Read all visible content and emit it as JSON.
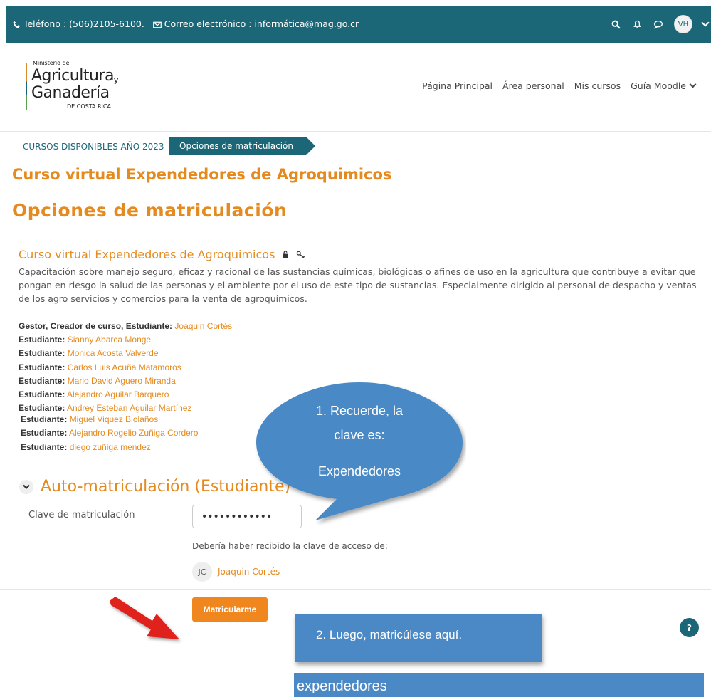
{
  "topbar": {
    "phone": "Teléfono : (506)2105-6100.",
    "email": "Correo electrónico : informática@mag.go.cr",
    "avatar_initials": "VH",
    "icons": [
      "phone-icon",
      "mail-icon",
      "search-icon",
      "bell-icon",
      "chat-icon",
      "chevron-down-icon"
    ]
  },
  "logo": {
    "line1": "Ministerio de",
    "line2": "Agricultura",
    "line2_suffix": "y",
    "line3": "Ganadería",
    "line4": "DE COSTA RICA"
  },
  "nav": {
    "items": [
      "Página Principal",
      "Área personal",
      "Mis cursos",
      "Guía Moodle"
    ]
  },
  "breadcrumb": {
    "items": [
      "CURSOS DISPONIBLES AÑO 2023",
      "Opciones de matriculación"
    ]
  },
  "course_title": "Curso virtual Expendedores de Agroquimicos",
  "page_title": "Opciones de matriculación",
  "course_box": {
    "title": "Curso virtual Expendedores de Agroquimicos",
    "description": "Capacitación sobre manejo seguro, eficaz y racional de las sustancias químicas, biológicas o afines de uso en la agricultura que contribuye a evitar que pongan en riesgo la salud de las personas y el ambiente por el uso de este tipo de sustancias. Especialmente dirigido al personal de despacho y ventas de los agro servicios y comercios para la venta de agroquímicos."
  },
  "contacts": [
    {
      "role": "Gestor, Creador de curso, Estudiante:",
      "name": "Joaquin Cortés"
    },
    {
      "role": "Estudiante:",
      "name": "Sianny Abarca Monge"
    },
    {
      "role": "Estudiante:",
      "name": "Monica Acosta Valverde"
    },
    {
      "role": "Estudiante:",
      "name": "Carlos Luis Acuña Matamoros"
    },
    {
      "role": "Estudiante:",
      "name": "Mario David Aguero Miranda"
    },
    {
      "role": "Estudiante:",
      "name": "Alejandro Aguilar Barquero"
    },
    {
      "role": "Estudiante:",
      "name": "Andrey Esteban Aguilar Martínez"
    },
    {
      "role": "Estudiante:",
      "name": "Miguel Viquez Biolaños"
    },
    {
      "role": "Estudiante:",
      "name": "Alejandro Rogelio Zuñiga Cordero"
    },
    {
      "role": "Estudiante:",
      "name": "diego zuñiga mendez"
    }
  ],
  "bubble": {
    "line1": "1. Recuerde, la",
    "line2": "clave es:",
    "line3": "Expendedores"
  },
  "enrol": {
    "heading": "Auto-matriculación (Estudiante)",
    "key_label": "Clave de matriculación",
    "key_value": "••••••••••••",
    "hint": "Debería haber recibido la clave de acceso de:",
    "teacher_initials": "JC",
    "teacher_name": "Joaquin Cortés",
    "submit_label": "Matricularme"
  },
  "note2": "2. Luego, matricúlese aquí.",
  "strip": "expendedores",
  "help_label": "?",
  "colors": {
    "brand": "#1b6777",
    "accent": "#e58a1f",
    "button": "#f0861e",
    "callout": "#4a89c5",
    "arrow": "#e0241c"
  }
}
